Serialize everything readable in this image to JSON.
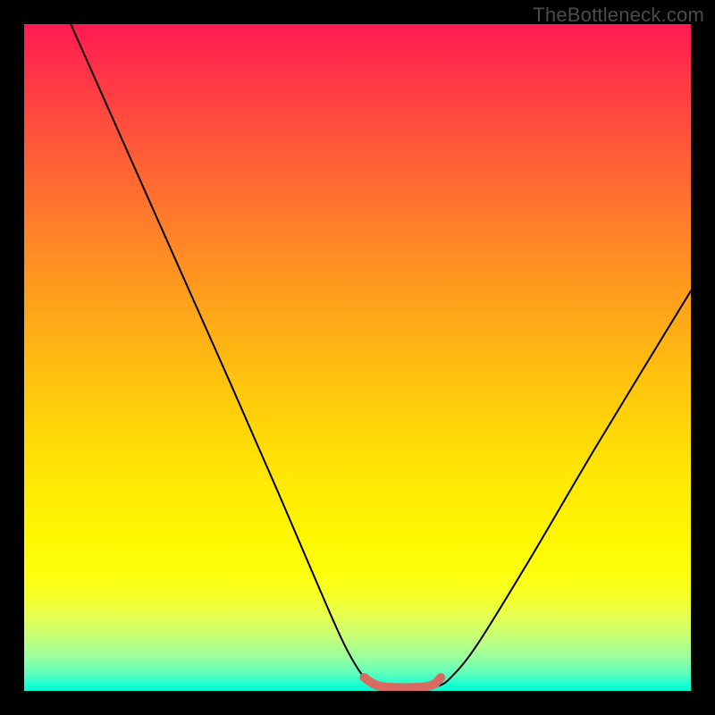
{
  "watermark": "TheBottleneck.com",
  "chart_data": {
    "type": "line",
    "title": "",
    "xlabel": "",
    "ylabel": "",
    "xlim": [
      0,
      100
    ],
    "ylim": [
      0,
      100
    ],
    "series": [
      {
        "name": "bottleneck-curve",
        "x": [
          7,
          15,
          23,
          31,
          38,
          44,
          48,
          51,
          53,
          55,
          60,
          62,
          64,
          68,
          76,
          86,
          100
        ],
        "y": [
          100,
          82,
          64,
          46,
          30,
          16,
          7,
          2,
          0.7,
          0.5,
          0.5,
          0.7,
          2,
          7,
          20,
          37,
          60
        ]
      },
      {
        "name": "valley-highlight",
        "x": [
          51,
          52.5,
          54,
          56,
          58,
          60,
          61.5,
          62.5
        ],
        "y": [
          2,
          1.0,
          0.6,
          0.5,
          0.5,
          0.6,
          1.0,
          2
        ]
      }
    ],
    "colors": {
      "curve": "#000000",
      "highlight": "#d96a62",
      "gradient_top": "#ff1a52",
      "gradient_bottom": "#00ffd0"
    }
  }
}
